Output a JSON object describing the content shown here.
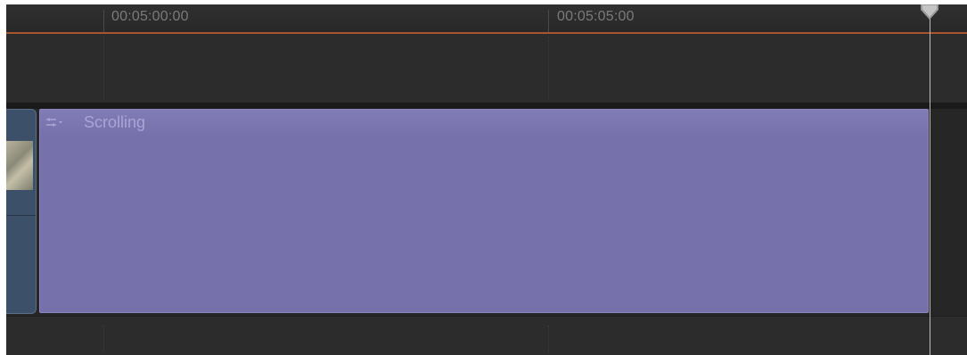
{
  "ruler": {
    "timecodes": [
      {
        "label": "00:05:00:00"
      },
      {
        "label": "00:05:05:00"
      }
    ]
  },
  "title_clip": {
    "name": "Scrolling",
    "icon": "title-generator-icon",
    "color": "#7671aa"
  },
  "video_clip": {
    "color": "#3c5169"
  },
  "playhead": {
    "icon": "playhead-icon"
  },
  "colors": {
    "ruler_accent": "#a8542e",
    "background": "#2a2a2a"
  }
}
